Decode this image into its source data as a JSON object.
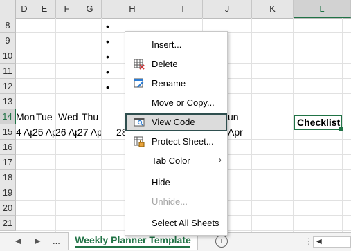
{
  "columns": [
    "D",
    "E",
    "F",
    "G",
    "H",
    "I",
    "J",
    "K",
    "L"
  ],
  "selected_column": "L",
  "rows": [
    "8",
    "9",
    "10",
    "11",
    "12",
    "13",
    "14",
    "15",
    "16",
    "17",
    "18",
    "19",
    "20",
    "21"
  ],
  "selected_row": "14",
  "bullets": [
    "•",
    "•",
    "•",
    "•",
    "•"
  ],
  "row14": {
    "mon": "Mon",
    "tue": "Tue",
    "wed": "Wed",
    "thu": "Thu",
    "sun_partial": "un",
    "checklist": "Checklist"
  },
  "row15": {
    "d": "4 Ap",
    "e": "25 Apr",
    "f": "26 Apr",
    "g": "27 Apr",
    "h_partial": "28",
    "j_partial": "Apr"
  },
  "context_menu": {
    "insert": "Insert...",
    "delete": "Delete",
    "rename": "Rename",
    "move_copy": "Move or Copy...",
    "view_code": "View Code",
    "protect": "Protect Sheet...",
    "tab_color": "Tab Color",
    "hide": "Hide",
    "unhide": "Unhide...",
    "select_all": "Select All Sheets"
  },
  "tabs": {
    "ellipsis": "...",
    "active": "Weekly Planner Template",
    "add": "+"
  },
  "colors": {
    "accent": "#217346",
    "highlight_border": "#2f4f4f"
  }
}
